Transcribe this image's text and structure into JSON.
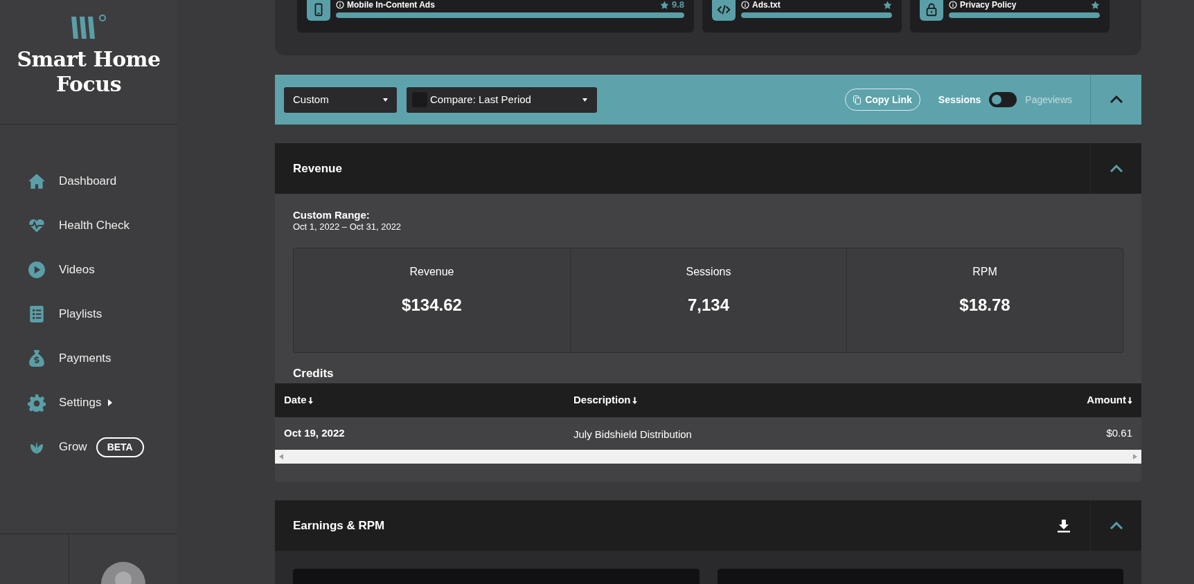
{
  "sidebar": {
    "site_name": "Smart Home Focus",
    "items": [
      {
        "label": "Dashboard",
        "selected": false
      },
      {
        "label": "Health Check",
        "selected": false
      },
      {
        "label": "Videos",
        "selected": false
      },
      {
        "label": "Playlists",
        "selected": false
      },
      {
        "label": "Payments",
        "selected": false
      },
      {
        "label": "Settings",
        "selected": false,
        "submenu": true
      },
      {
        "label": "Grow",
        "selected": false,
        "badge": "BETA"
      }
    ]
  },
  "health_cards": [
    {
      "title": "Mobile In-Content Ads",
      "score": "9.8",
      "level": 1
    },
    {
      "title": "Ads.txt",
      "level": 1
    },
    {
      "title": "Privacy Policy",
      "level": 1
    }
  ],
  "filter_bar": {
    "range": "Custom",
    "compare": {
      "label": "Compare: Last Period",
      "checked": false
    },
    "copy_link": "Copy Link",
    "toggle": {
      "left": "Sessions",
      "right": "Pageviews",
      "on": false
    },
    "expanded": true
  },
  "revenue": {
    "title": "Revenue",
    "expanded": true,
    "range_label": "Custom Range:",
    "range": "Oct 1, 2022 – Oct 31, 2022",
    "stats": [
      {
        "label": "Revenue",
        "value": "$134.62"
      },
      {
        "label": "Sessions",
        "value": "7,134"
      },
      {
        "label": "RPM",
        "value": "$18.78"
      }
    ],
    "credits": {
      "title": "Credits",
      "columns": [
        "Date",
        "Description",
        "Amount"
      ],
      "rows": [
        [
          "Oct 19, 2022",
          "July Bidshield Distribution",
          "$0.61"
        ]
      ]
    }
  },
  "earnings": {
    "title": "Earnings & RPM",
    "expanded": true
  }
}
